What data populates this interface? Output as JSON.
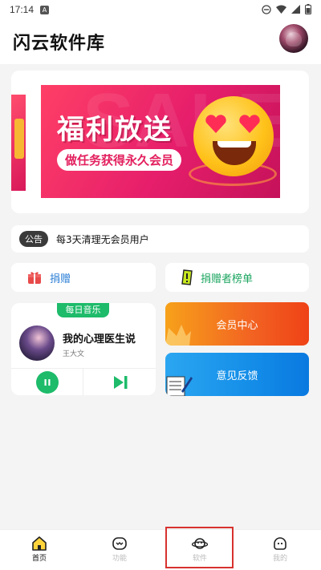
{
  "status_bar": {
    "time": "17:14",
    "notification_icon": "A"
  },
  "header": {
    "title": "闪云软件库"
  },
  "banner": {
    "title": "福利放送",
    "subtitle": "做任务获得永久会员",
    "watermark": "SALE"
  },
  "notice": {
    "tag": "公告",
    "text": "每3天清理无会员用户"
  },
  "actions": {
    "donate_label": "捐赠",
    "donor_rank_label": "捐赠者榜单"
  },
  "music": {
    "badge": "每日音乐",
    "song": "我的心理医生说",
    "artist": "王大文"
  },
  "cards": {
    "vip_label": "会员中心",
    "feedback_label": "意见反馈"
  },
  "tabs": [
    {
      "label": "首页",
      "active": true
    },
    {
      "label": "功能",
      "active": false
    },
    {
      "label": "软件",
      "active": false
    },
    {
      "label": "我的",
      "active": false
    }
  ],
  "colors": {
    "accent_green": "#1dbb6a",
    "accent_blue": "#2c7fd6",
    "vip_orange": "#f26322",
    "feedback_blue": "#148de8",
    "highlight_red": "#d8322e"
  }
}
